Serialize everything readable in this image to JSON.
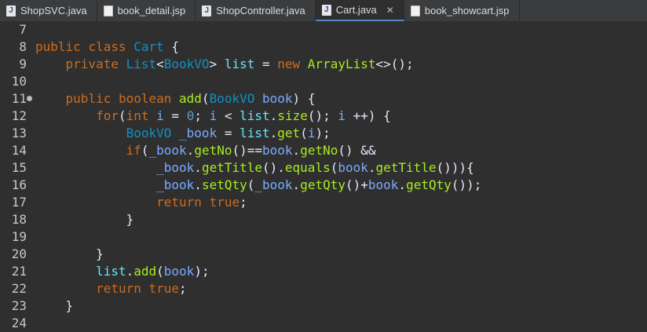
{
  "tabs": [
    {
      "label": "ShopSVC.java",
      "icon": "java-file-icon",
      "icon_glyph": "J",
      "active": false
    },
    {
      "label": "book_detail.jsp",
      "icon": "jsp-file-icon",
      "icon_glyph": "",
      "active": false
    },
    {
      "label": "ShopController.java",
      "icon": "java-file-icon",
      "icon_glyph": "J",
      "active": false
    },
    {
      "label": "Cart.java",
      "icon": "java-file-icon",
      "icon_glyph": "J",
      "active": true,
      "close": "✕"
    },
    {
      "label": "book_showcart.jsp",
      "icon": "jsp-file-icon",
      "icon_glyph": "",
      "active": false
    }
  ],
  "editor": {
    "line_numbers": [
      "7",
      "8",
      "9",
      "10",
      "11",
      "12",
      "13",
      "14",
      "15",
      "16",
      "17",
      "18",
      "19",
      "20",
      "21",
      "22",
      "23",
      "24"
    ],
    "lines": [
      [],
      [
        [
          "public ",
          "kw"
        ],
        [
          "class ",
          "kw"
        ],
        [
          "Cart",
          "cls"
        ],
        [
          " {",
          "op"
        ]
      ],
      [
        [
          "    ",
          "op"
        ],
        [
          "private ",
          "kw"
        ],
        [
          "List",
          "cls"
        ],
        [
          "<",
          "op"
        ],
        [
          "BookVO",
          "cls"
        ],
        [
          "> ",
          "op"
        ],
        [
          "list",
          "fld"
        ],
        [
          " = ",
          "op"
        ],
        [
          "new ",
          "kw"
        ],
        [
          "ArrayList",
          "mth"
        ],
        [
          "<>();",
          "op"
        ]
      ],
      [],
      [
        [
          "    ",
          "op"
        ],
        [
          "public ",
          "kw"
        ],
        [
          "boolean ",
          "kw"
        ],
        [
          "add",
          "mth"
        ],
        [
          "(",
          "op"
        ],
        [
          "BookVO ",
          "cls"
        ],
        [
          "book",
          "var"
        ],
        [
          ") {",
          "op"
        ]
      ],
      [
        [
          "        ",
          "op"
        ],
        [
          "for",
          "kw"
        ],
        [
          "(",
          "op"
        ],
        [
          "int ",
          "kw"
        ],
        [
          "i",
          "var"
        ],
        [
          " = ",
          "op"
        ],
        [
          "0",
          "num"
        ],
        [
          "; ",
          "op"
        ],
        [
          "i",
          "var"
        ],
        [
          " < ",
          "op"
        ],
        [
          "list",
          "fld"
        ],
        [
          ".",
          "op"
        ],
        [
          "size",
          "mth"
        ],
        [
          "(); ",
          "op"
        ],
        [
          "i",
          "var"
        ],
        [
          " ++) {",
          "op"
        ]
      ],
      [
        [
          "            ",
          "op"
        ],
        [
          "BookVO ",
          "cls"
        ],
        [
          "_book",
          "var"
        ],
        [
          " = ",
          "op"
        ],
        [
          "list",
          "fld"
        ],
        [
          ".",
          "op"
        ],
        [
          "get",
          "mth"
        ],
        [
          "(",
          "op"
        ],
        [
          "i",
          "var"
        ],
        [
          ");",
          "op"
        ]
      ],
      [
        [
          "            ",
          "op"
        ],
        [
          "if",
          "kw"
        ],
        [
          "(",
          "op"
        ],
        [
          "_book",
          "var"
        ],
        [
          ".",
          "op"
        ],
        [
          "getNo",
          "mth"
        ],
        [
          "()==",
          "op"
        ],
        [
          "book",
          "var"
        ],
        [
          ".",
          "op"
        ],
        [
          "getNo",
          "mth"
        ],
        [
          "() &&",
          "op"
        ]
      ],
      [
        [
          "                ",
          "op"
        ],
        [
          "_book",
          "var"
        ],
        [
          ".",
          "op"
        ],
        [
          "getTitle",
          "mth"
        ],
        [
          "().",
          "op"
        ],
        [
          "equals",
          "mth"
        ],
        [
          "(",
          "op"
        ],
        [
          "book",
          "var"
        ],
        [
          ".",
          "op"
        ],
        [
          "getTitle",
          "mth"
        ],
        [
          "())){",
          "op"
        ]
      ],
      [
        [
          "                ",
          "op"
        ],
        [
          "_book",
          "var"
        ],
        [
          ".",
          "op"
        ],
        [
          "setQty",
          "mth"
        ],
        [
          "(",
          "op"
        ],
        [
          "_book",
          "var"
        ],
        [
          ".",
          "op"
        ],
        [
          "getQty",
          "mth"
        ],
        [
          "()+",
          "op"
        ],
        [
          "book",
          "var"
        ],
        [
          ".",
          "op"
        ],
        [
          "getQty",
          "mth"
        ],
        [
          "());",
          "op"
        ]
      ],
      [
        [
          "                ",
          "op"
        ],
        [
          "return ",
          "kw"
        ],
        [
          "true",
          "lit"
        ],
        [
          ";",
          "op"
        ]
      ],
      [
        [
          "            ",
          "op"
        ],
        [
          "}",
          "op"
        ]
      ],
      [],
      [
        [
          "        ",
          "op"
        ],
        [
          "}",
          "op"
        ]
      ],
      [
        [
          "        ",
          "op"
        ],
        [
          "list",
          "fld"
        ],
        [
          ".",
          "op"
        ],
        [
          "add",
          "mth"
        ],
        [
          "(",
          "op"
        ],
        [
          "book",
          "var"
        ],
        [
          ");",
          "op"
        ]
      ],
      [
        [
          "        ",
          "op"
        ],
        [
          "return ",
          "kw"
        ],
        [
          "true",
          "lit"
        ],
        [
          ";",
          "op"
        ]
      ],
      [
        [
          "    ",
          "op"
        ],
        [
          "}",
          "op"
        ]
      ],
      []
    ],
    "fold_marker_line": "11"
  }
}
